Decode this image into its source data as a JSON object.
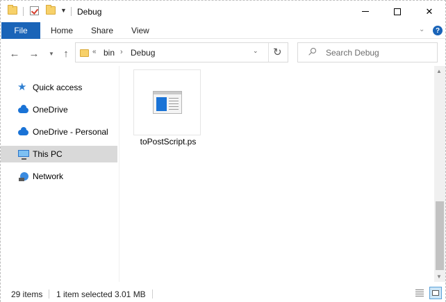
{
  "window": {
    "title": "Debug",
    "controls": {
      "minimize": "minimize",
      "maximize": "maximize",
      "close": "✕"
    }
  },
  "ribbon": {
    "tabs": [
      {
        "label": "File"
      },
      {
        "label": "Home"
      },
      {
        "label": "Share"
      },
      {
        "label": "View"
      }
    ],
    "help": "?"
  },
  "navigation": {
    "back": "←",
    "forward": "→",
    "recent": "⌄",
    "up": "↑",
    "address": {
      "overflow": "«",
      "crumbs": [
        "bin",
        "Debug"
      ],
      "separator": "›"
    },
    "refresh": "↻",
    "search": {
      "placeholder": "Search Debug"
    }
  },
  "nav_pane": {
    "items": [
      {
        "label": "Quick access",
        "icon": "star-icon"
      },
      {
        "label": "OneDrive",
        "icon": "cloud-icon"
      },
      {
        "label": "OneDrive - Personal",
        "icon": "cloud-icon"
      },
      {
        "label": "This PC",
        "icon": "computer-icon",
        "selected": true
      },
      {
        "label": "Network",
        "icon": "network-icon"
      }
    ]
  },
  "files": [
    {
      "name": "toPostScript.ps",
      "icon": "document-icon"
    }
  ],
  "status": {
    "count": "29 items",
    "selection": "1 item selected",
    "size": "3.01 MB"
  },
  "colors": {
    "accent": "#1a64b8",
    "selection": "#d9d9d9",
    "folder": "#f7d16a"
  }
}
